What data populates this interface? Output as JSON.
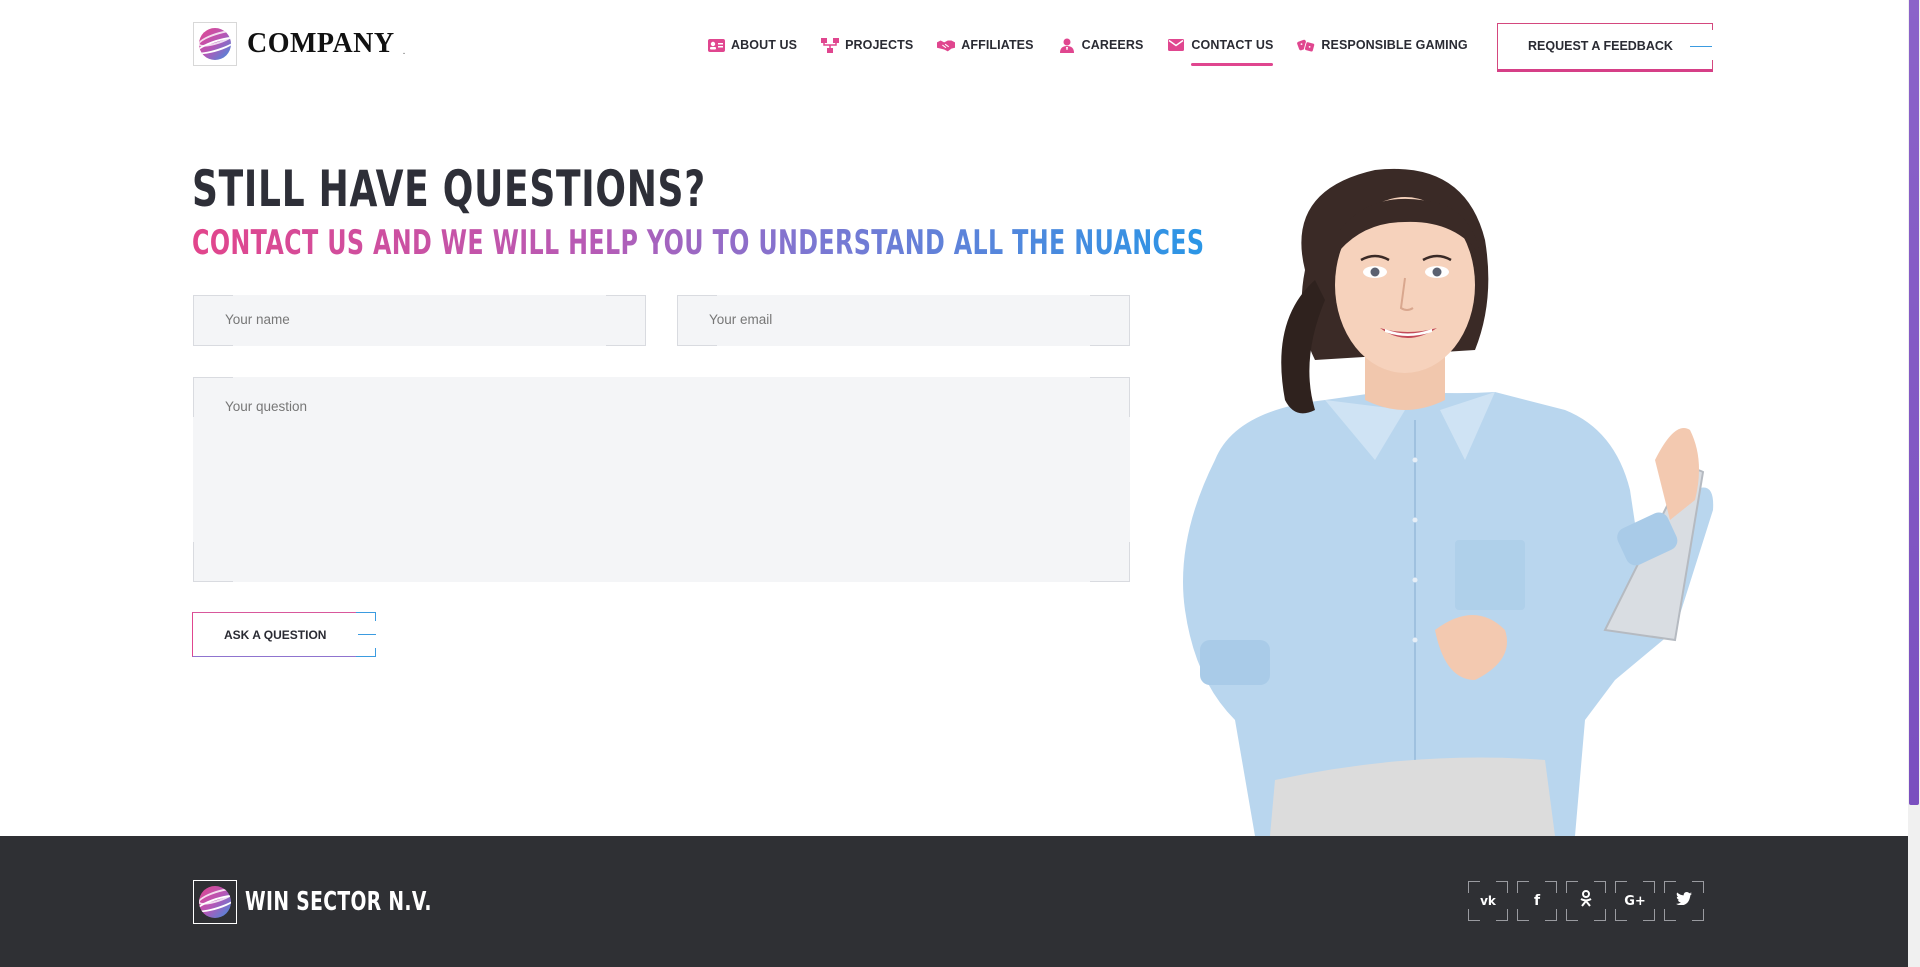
{
  "header": {
    "logo_text": "COMPANY",
    "logo_suffix": ".",
    "nav": [
      {
        "label": "ABOUT US",
        "icon": "id-card-icon"
      },
      {
        "label": "PROJECTS",
        "icon": "sitemap-icon"
      },
      {
        "label": "AFFILIATES",
        "icon": "handshake-icon"
      },
      {
        "label": "CAREERS",
        "icon": "user-tie-icon"
      },
      {
        "label": "CONTACT US",
        "icon": "envelope-icon",
        "active": true
      },
      {
        "label": "RESPONSIBLE GAMING",
        "icon": "dice-icon"
      }
    ],
    "feedback_button": "REQUEST A FEEDBACK"
  },
  "main": {
    "title": "STILL HAVE QUESTIONS?",
    "subtitle": "CONTACT US AND WE WILL HELP YOU TO UNDERSTAND ALL THE NUANCES",
    "form": {
      "name_placeholder": "Your name",
      "email_placeholder": "Your email",
      "question_placeholder": "Your question",
      "submit_label": "ASK A QUESTION"
    }
  },
  "footer": {
    "company_name": "WIN SECTOR N.V.",
    "socials": [
      {
        "name": "vk",
        "glyph": "vk"
      },
      {
        "name": "facebook",
        "glyph": "f"
      },
      {
        "name": "odnoklassniki",
        "glyph": "ok"
      },
      {
        "name": "google-plus",
        "glyph": "G+"
      },
      {
        "name": "twitter",
        "glyph": "tw"
      }
    ]
  },
  "colors": {
    "accent_pink": "#e0468f",
    "accent_purple": "#8b63c9",
    "accent_blue": "#2a96e6",
    "footer_bg": "#2f3034",
    "heading": "#2e2f38"
  }
}
